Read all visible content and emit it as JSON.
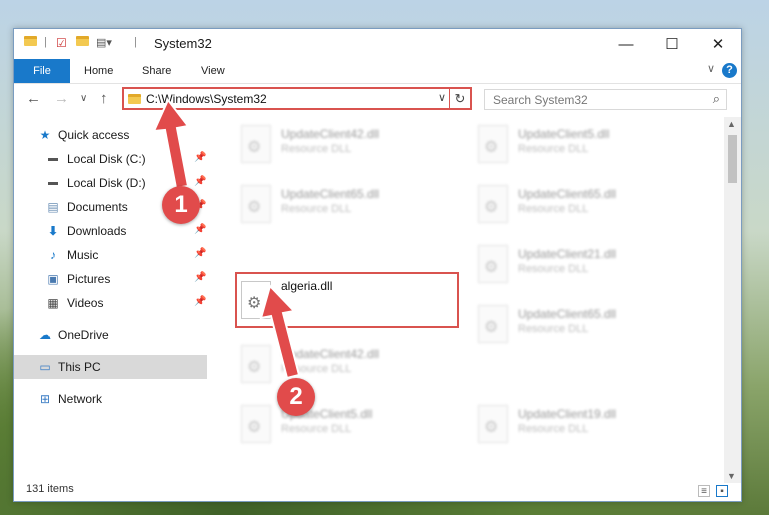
{
  "window": {
    "title": "System32",
    "minimize_label": "—",
    "maximize_label": "☐",
    "close_label": "✕"
  },
  "ribbon": {
    "tabs": [
      "File",
      "Home",
      "Share",
      "View"
    ],
    "help_label": "?",
    "expand_label": "∨"
  },
  "nav": {
    "back": "←",
    "forward": "→",
    "recent": "∨",
    "up": "↑",
    "address": "C:\\Windows\\System32",
    "address_dropdown": "∨",
    "refresh": "↻",
    "search_placeholder": "Search System32",
    "search_icon": "⌕"
  },
  "sidebar": {
    "items": [
      {
        "label": "Quick access",
        "icon": "star-icon"
      },
      {
        "label": "Local Disk (C:)",
        "icon": "drive-icon"
      },
      {
        "label": "Local Disk (D:)",
        "icon": "drive-icon"
      },
      {
        "label": "Documents",
        "icon": "documents-icon"
      },
      {
        "label": "Downloads",
        "icon": "download-icon"
      },
      {
        "label": "Music",
        "icon": "music-icon"
      },
      {
        "label": "Pictures",
        "icon": "pictures-icon"
      },
      {
        "label": "Videos",
        "icon": "videos-icon"
      },
      {
        "label": "OneDrive",
        "icon": "cloud-icon"
      },
      {
        "label": "This PC",
        "icon": "computer-icon"
      },
      {
        "label": "Network",
        "icon": "network-icon"
      }
    ]
  },
  "files": [
    {
      "name": "UpdateClient42.dll",
      "type": "Resource DLL"
    },
    {
      "name": "UpdateClient5.dll",
      "type": "Resource DLL"
    },
    {
      "name": "UpdateClient65.dll",
      "type": "Resource DLL"
    },
    {
      "name": "UpdateClient65.dll",
      "type": "Resource DLL"
    },
    {
      "name": "algeria.dll",
      "type": ""
    },
    {
      "name": "UpdateClient21.dll",
      "type": "Resource DLL"
    },
    {
      "name": "UpdateClient42.dll",
      "type": "Resource DLL"
    },
    {
      "name": "UpdateClient65.dll",
      "type": "Resource DLL"
    },
    {
      "name": "UpdateClient5.dll",
      "type": "Resource DLL"
    },
    {
      "name": "UpdateClient19.dll",
      "type": "Resource DLL"
    }
  ],
  "status": {
    "item_count": "131 items"
  },
  "callouts": [
    "1",
    "2"
  ],
  "colors": {
    "accent": "#1979ca",
    "highlight": "#d9534f",
    "callout": "#e14b4b"
  }
}
